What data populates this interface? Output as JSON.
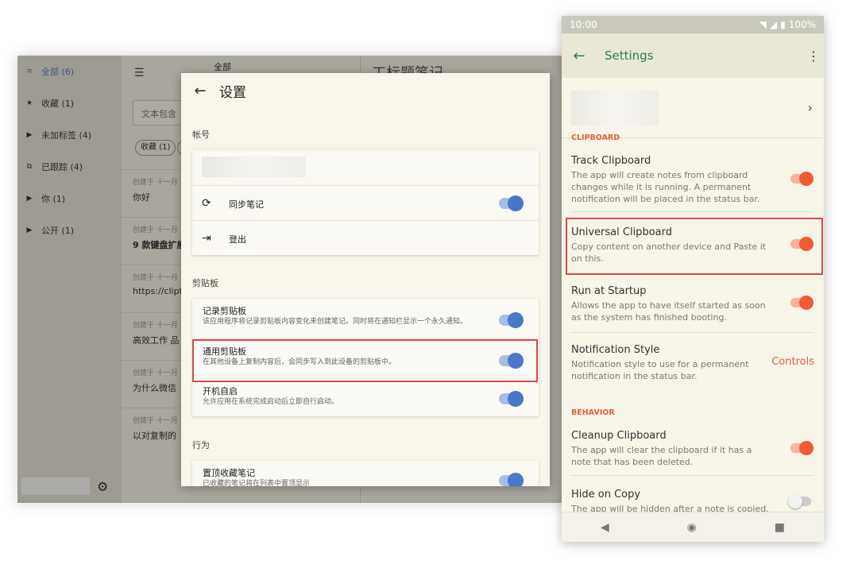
{
  "desktop": {
    "sidebar": {
      "items": [
        {
          "icon": "filter-icon",
          "glyph": "≡",
          "label": "全部 (6)"
        },
        {
          "icon": "star-icon",
          "glyph": "★",
          "label": "收藏 (1)"
        },
        {
          "icon": "tag-off-icon",
          "glyph": "▶",
          "label": "未加标签 (4)"
        },
        {
          "icon": "copy-icon",
          "glyph": "⧉",
          "label": "已跟踪 (4)"
        },
        {
          "icon": "tag-icon",
          "glyph": "▶",
          "label": "你 (1)"
        },
        {
          "icon": "tag-icon",
          "glyph": "▶",
          "label": "公开 (1)"
        }
      ]
    },
    "list": {
      "header_label": "全部",
      "filter_placeholder": "文本包含",
      "chip": "收藏 (1)",
      "notes": [
        {
          "meta": "创建于 十一月",
          "text": "你好"
        },
        {
          "meta": "创建于 十一月",
          "text": "9 款键盘扩展"
        },
        {
          "meta": "创建于 十一月",
          "text": "https://clipt"
        },
        {
          "meta": "创建于 十一月",
          "text": "高效工作 品"
        },
        {
          "meta": "创建于 十一月",
          "text": "为什么微信"
        },
        {
          "meta": "创建于 十一月",
          "text": "以对复制的"
        }
      ]
    },
    "detail_title": "工标题笔记"
  },
  "dialog": {
    "title": "设置",
    "account_section": "帐号",
    "sync_label": "同步笔记",
    "logout_label": "登出",
    "clipboard_section": "剪贴板",
    "track": {
      "title": "记录剪贴板",
      "sub": "该应用程序将记录剪贴板内容变化来创建笔记。同时将在通知栏显示一个永久通知。"
    },
    "universal": {
      "title": "通用剪贴板",
      "sub": "在其他设备上复制内容后，会同步写入到此设备的剪贴板中。"
    },
    "startup": {
      "title": "开机自启",
      "sub": "允许应用在系统完成启动后立即自行启动。"
    },
    "behavior_section": "行为",
    "pin": {
      "title": "置顶收藏笔记",
      "sub": "已收藏的笔记将在列表中置顶显示"
    }
  },
  "phone": {
    "status": {
      "time": "10:00",
      "battery": "100%"
    },
    "appbar_title": "Settings",
    "clipboard_section": "CLIPBOARD",
    "items": {
      "track": {
        "title": "Track Clipboard",
        "sub": "The app will create notes from clipboard changes while it is running. A permanent notification will be placed in the status bar."
      },
      "universal": {
        "title": "Universal Clipboard",
        "sub": "Copy content on another device and Paste it on this."
      },
      "startup": {
        "title": "Run at Startup",
        "sub": "Allows the app to have itself started as soon as the system has finished booting."
      },
      "notif": {
        "title": "Notification Style",
        "sub": "Notification style to use for a permanent notification in the status bar.",
        "value": "Controls"
      },
      "cleanup": {
        "title": "Cleanup Clipboard",
        "sub": "The app will clear the clipboard if it has a note that has been deleted."
      },
      "hide": {
        "title": "Hide on Copy",
        "sub": "The app will be hidden after a note is copied."
      }
    },
    "behavior_section": "BEHAVIOR"
  },
  "colors": {
    "accent_red": "#d64b4b",
    "phone_accent": "#e4603c",
    "toggle_blue": "#4a77c9",
    "toggle_orange": "#ef5b34"
  }
}
